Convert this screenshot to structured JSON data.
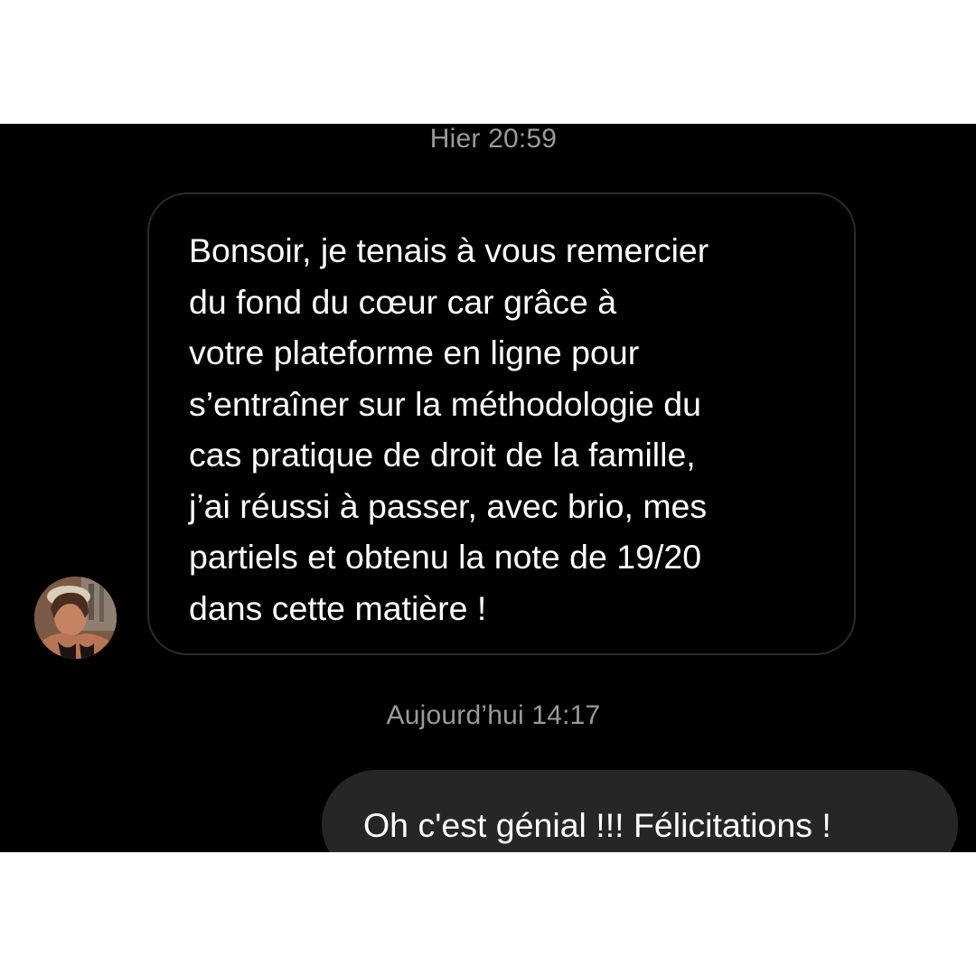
{
  "conversation": {
    "timestamp_yesterday": "Hier 20:59",
    "incoming_message": "Bonsoir, je tenais à vous remercier\ndu fond du cœur car grâce à\nvotre plateforme en ligne pour\ns’entraîner sur la méthodologie du\ncas pratique de droit de la famille,\nj’ai réussi à passer, avec brio, mes\npartiels et obtenu la note de 19/20\ndans cette matière !",
    "timestamp_today": "Aujourd’hui 14:17",
    "outgoing_message": "Oh c'est génial !!! Félicitations !"
  },
  "colors": {
    "background": "#000000",
    "incoming_bubble_border": "#2b2b2b",
    "outgoing_bubble": "#262626",
    "timestamp": "#9a9a9a",
    "text": "#ffffff"
  },
  "avatar": {
    "icon": "user-photo-avatar"
  }
}
